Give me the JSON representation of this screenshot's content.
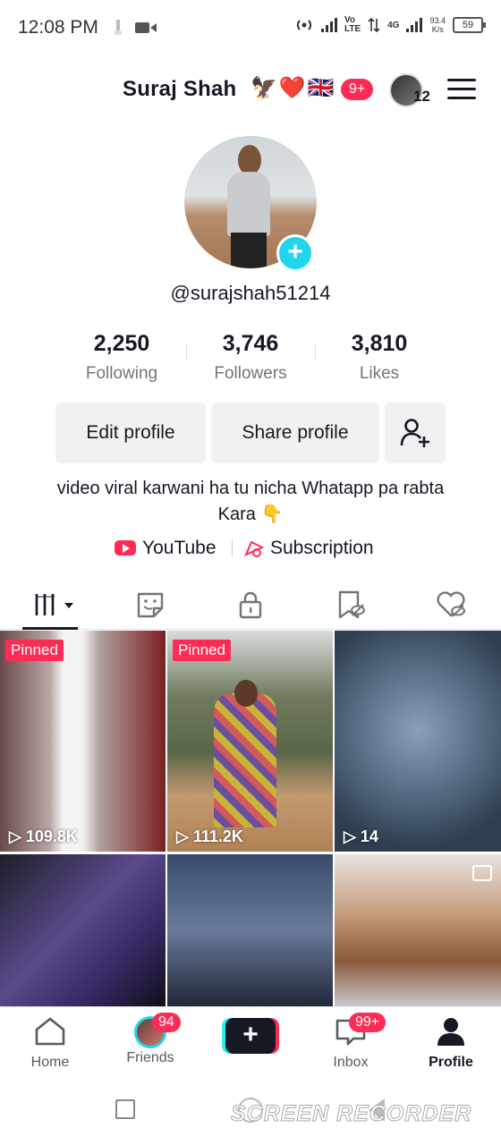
{
  "status_bar": {
    "time": "12:08 PM",
    "net_label": "Vo\nLTE",
    "net_4g": "4G",
    "speed": "93.4\nK/s",
    "battery": "59"
  },
  "header": {
    "name": "Suraj Shah",
    "emojis": "🦅❤️🇬🇧",
    "notification_badge": "9+",
    "avatar_count": "12"
  },
  "profile": {
    "username": "@surajshah51214",
    "stats": [
      {
        "value": "2,250",
        "label": "Following"
      },
      {
        "value": "3,746",
        "label": "Followers"
      },
      {
        "value": "3,810",
        "label": "Likes"
      }
    ],
    "edit_label": "Edit profile",
    "share_label": "Share profile",
    "bio": "video viral karwani ha tu nicha Whatapp pa rabta Kara 👇",
    "youtube_label": "YouTube",
    "subscription_label": "Subscription"
  },
  "grid": {
    "pinned_label": "Pinned",
    "items": [
      {
        "views": "109.8K",
        "pinned": true
      },
      {
        "views": "111.2K",
        "pinned": true
      },
      {
        "views": "14",
        "pinned": false
      },
      {
        "views": "",
        "pinned": false
      },
      {
        "views": "",
        "pinned": false
      },
      {
        "views": "",
        "pinned": false
      }
    ]
  },
  "bottom_nav": {
    "home": "Home",
    "friends": "Friends",
    "friends_badge": "94",
    "inbox": "Inbox",
    "inbox_badge": "99+",
    "profile": "Profile"
  },
  "watermark": "SCREEN RECORDER",
  "colors": {
    "accent": "#fe2c55",
    "teal": "#20d5ec",
    "text": "#161823"
  }
}
